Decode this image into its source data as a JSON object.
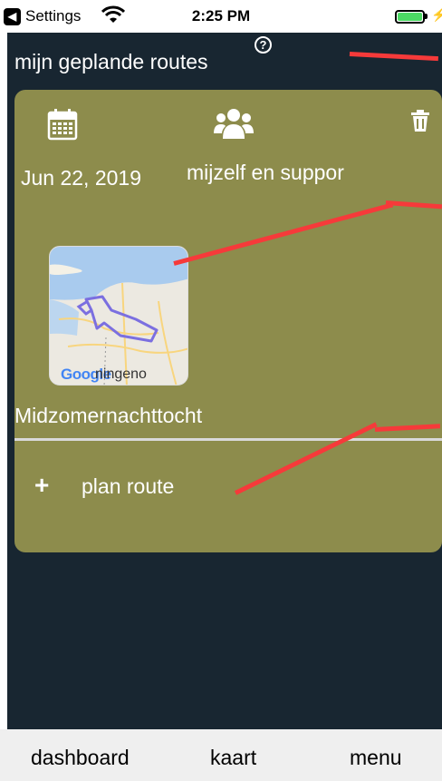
{
  "status_bar": {
    "back_app": "Settings",
    "time": "2:25 PM"
  },
  "header": {
    "title": "mijn geplande routes"
  },
  "route_card": {
    "date": "Jun 22, 2019",
    "participants": "mijzelf en suppor",
    "route_name": "Midzomernachttocht",
    "map": {
      "provider": "Google",
      "place_label": "ningeno"
    }
  },
  "actions": {
    "plan_route": "plan route"
  },
  "tabs": [
    {
      "label": "dashboard"
    },
    {
      "label": "kaart"
    },
    {
      "label": "menu"
    }
  ],
  "colors": {
    "background": "#182631",
    "card": "#8d8c4c",
    "annotation_line": "#f63a3a",
    "battery": "#4cd964",
    "tab_bar": "#efefef"
  },
  "icons": [
    "calendar-icon",
    "group-icon",
    "trash-icon",
    "help-icon",
    "plus-icon",
    "wifi-icon",
    "battery-icon"
  ]
}
